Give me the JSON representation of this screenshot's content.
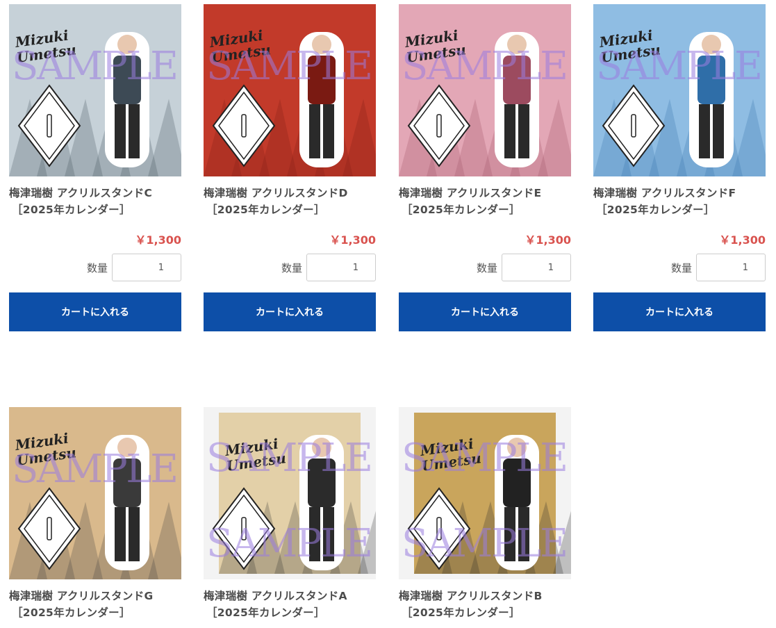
{
  "products": [
    {
      "name": "梅津瑞樹 アクリルスタンドC",
      "category": "［2025年カレンダー］",
      "price": "￥1,300",
      "qty_label": "数量",
      "qty": "1",
      "cart_label": "カートに入れる",
      "sample_text": "SAMPLE",
      "bg": "#c6d1d8",
      "accent": "#3d4a55"
    },
    {
      "name": "梅津瑞樹 アクリルスタンドD",
      "category": "［2025年カレンダー］",
      "price": "￥1,300",
      "qty_label": "数量",
      "qty": "1",
      "cart_label": "カートに入れる",
      "sample_text": "SAMPLE",
      "bg": "#c23a2a",
      "accent": "#7a1a12"
    },
    {
      "name": "梅津瑞樹 アクリルスタンドE",
      "category": "［2025年カレンダー］",
      "price": "￥1,300",
      "qty_label": "数量",
      "qty": "1",
      "cart_label": "カートに入れる",
      "sample_text": "SAMPLE",
      "bg": "#e3a7b6",
      "accent": "#9c4b5f"
    },
    {
      "name": "梅津瑞樹 アクリルスタンドF",
      "category": "［2025年カレンダー］",
      "price": "￥1,300",
      "qty_label": "数量",
      "qty": "1",
      "cart_label": "カートに入れる",
      "sample_text": "SAMPLE",
      "bg": "#8fbde3",
      "accent": "#2f6ea8"
    },
    {
      "name": "梅津瑞樹 アクリルスタンドG",
      "category": "［2025年カレンダー］",
      "sample_text": "SAMPLE",
      "bg": "#d9b98c",
      "accent": "#3a3a3a"
    },
    {
      "name": "梅津瑞樹 アクリルスタンドA",
      "category": "［2025年カレンダー］",
      "sample_text": "SAMPLE",
      "bg": "#e3d0a8",
      "accent": "#2b2b2b"
    },
    {
      "name": "梅津瑞樹 アクリルスタンドB",
      "category": "［2025年カレンダー］",
      "sample_text": "SAMPLE",
      "bg": "#c9a55c",
      "accent": "#222222"
    }
  ],
  "thumb_text": {
    "line1": "Mizuki",
    "line2": "Umetsu"
  }
}
